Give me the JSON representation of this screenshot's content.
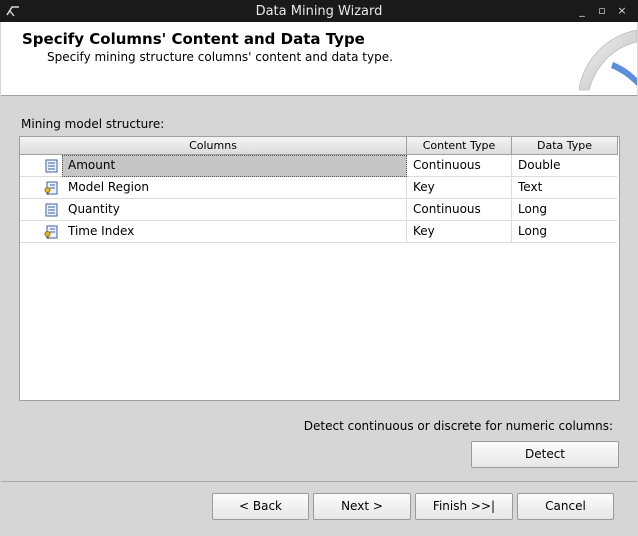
{
  "window": {
    "title": "Data Mining Wizard",
    "controls": [
      "_",
      "▫",
      "×"
    ]
  },
  "header": {
    "title": "Specify Columns' Content and Data Type",
    "subtitle": "Specify mining structure columns' content and data type."
  },
  "structure": {
    "label": "Mining model structure:",
    "columns": [
      "Columns",
      "Content Type",
      "Data Type"
    ],
    "rows": [
      {
        "icon": "column-icon",
        "name": "Amount",
        "content_type": "Continuous",
        "data_type": "Double"
      },
      {
        "icon": "key-column-icon",
        "name": "Model Region",
        "content_type": "Key",
        "data_type": "Text"
      },
      {
        "icon": "column-icon",
        "name": "Quantity",
        "content_type": "Continuous",
        "data_type": "Long"
      },
      {
        "icon": "key-column-icon",
        "name": "Time Index",
        "content_type": "Key",
        "data_type": "Long"
      }
    ]
  },
  "detect": {
    "label": "Detect continuous or discrete for numeric columns:",
    "button": "Detect"
  },
  "footer": {
    "back": "< Back",
    "next": "Next >",
    "finish": "Finish >>|",
    "cancel": "Cancel"
  }
}
